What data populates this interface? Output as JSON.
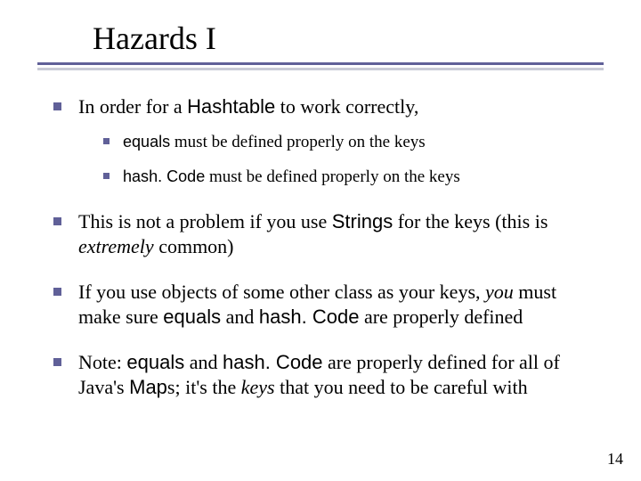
{
  "title": "Hazards I",
  "bullets": {
    "b1": {
      "pre": "In order for a ",
      "code": "Hashtable",
      "post": " to work correctly,",
      "sub": {
        "s1": {
          "code": "equals",
          "post": " must be defined properly on the keys"
        },
        "s2": {
          "code": "hash. Code",
          "post": " must be defined properly on the keys"
        }
      }
    },
    "b2": {
      "t1": "This is not a problem if you use ",
      "code1": "Strings",
      "t2": " for the keys (this is ",
      "em": "extremely",
      "t3": " common)"
    },
    "b3": {
      "t1": "If you use objects of some other class as your keys, ",
      "em": "you",
      "t2": " must make sure ",
      "code1": "equals",
      "t3": " and ",
      "code2": "hash. Code",
      "t4": " are properly defined"
    },
    "b4": {
      "t1": "Note: ",
      "code1": "equals",
      "t2": " and ",
      "code2": "hash. Code",
      "t3": " are properly defined for all of Java's ",
      "code3": "Map",
      "t4": "s; it's the ",
      "em": "keys",
      "t5": " that you need to be careful with"
    }
  },
  "page_number": "14"
}
